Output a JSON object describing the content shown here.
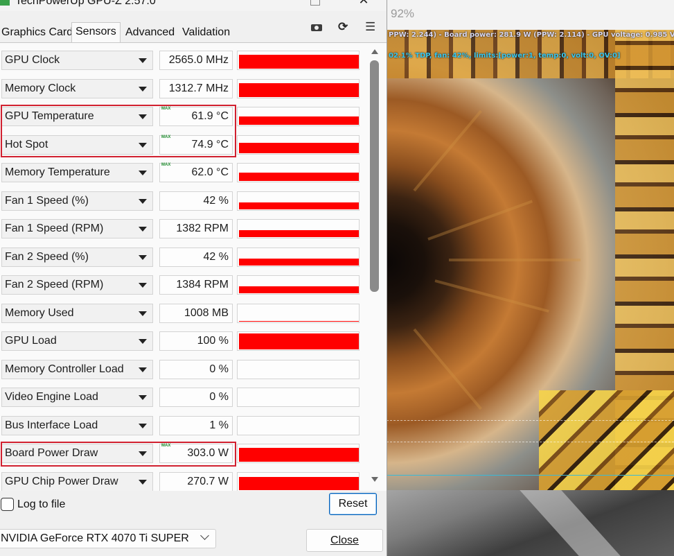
{
  "window": {
    "title": "TechPowerUp GPU-Z 2.57.0",
    "minimize_label": "—",
    "close_label": "✕"
  },
  "tabs": [
    {
      "label": "Graphics Card"
    },
    {
      "label": "Sensors",
      "active": true
    },
    {
      "label": "Advanced"
    },
    {
      "label": "Validation"
    }
  ],
  "toolbar": {
    "camera_icon": "camera-icon",
    "refresh_icon": "refresh-icon",
    "refresh_glyph": "⟳",
    "menu_icon": "hamburger-menu-icon",
    "menu_glyph": "☰"
  },
  "sensors": [
    {
      "name": "GPU Clock",
      "value": "2565.0 MHz",
      "max": false,
      "graph_level": 0.82,
      "highlighted": false
    },
    {
      "name": "Memory Clock",
      "value": "1312.7 MHz",
      "max": false,
      "graph_level": 0.85,
      "highlighted": false
    },
    {
      "name": "GPU Temperature",
      "value": "61.9 °C",
      "max": true,
      "max_label": "MAX",
      "graph_level": 0.5,
      "highlighted": true
    },
    {
      "name": "Hot Spot",
      "value": "74.9 °C",
      "max": true,
      "max_label": "MAX",
      "graph_level": 0.62,
      "highlighted": true
    },
    {
      "name": "Memory Temperature",
      "value": "62.0 °C",
      "max": true,
      "max_label": "MAX",
      "graph_level": 0.52,
      "highlighted": false
    },
    {
      "name": "Fan 1 Speed (%)",
      "value": "42 %",
      "max": false,
      "graph_level": 0.4,
      "highlighted": false
    },
    {
      "name": "Fan 1 Speed (RPM)",
      "value": "1382 RPM",
      "max": false,
      "graph_level": 0.4,
      "highlighted": false
    },
    {
      "name": "Fan 2 Speed (%)",
      "value": "42 %",
      "max": false,
      "graph_level": 0.4,
      "highlighted": false
    },
    {
      "name": "Fan 2 Speed (RPM)",
      "value": "1384 RPM",
      "max": false,
      "graph_level": 0.4,
      "highlighted": false
    },
    {
      "name": "Memory Used",
      "value": "1008 MB",
      "max": false,
      "graph_level": 0.06,
      "highlighted": false
    },
    {
      "name": "GPU Load",
      "value": "100 %",
      "max": false,
      "graph_level": 0.95,
      "highlighted": false
    },
    {
      "name": "Memory Controller Load",
      "value": "0 %",
      "max": false,
      "graph_level": 0,
      "highlighted": false
    },
    {
      "name": "Video Engine Load",
      "value": "0 %",
      "max": false,
      "graph_level": 0,
      "highlighted": false
    },
    {
      "name": "Bus Interface Load",
      "value": "1 %",
      "max": false,
      "graph_level": 0,
      "highlighted": false
    },
    {
      "name": "Board Power Draw",
      "value": "303.0 W",
      "max": true,
      "max_label": "MAX",
      "graph_level": 0.85,
      "highlighted": true
    },
    {
      "name": "GPU Chip Power Draw",
      "value": "270.7 W",
      "max": false,
      "graph_level": 0.8,
      "highlighted": false
    }
  ],
  "footer": {
    "log_label": "Log to file",
    "log_checked": false,
    "reset_label": "Reset",
    "gpu_select_value": "NVIDIA GeForce RTX 4070 Ti SUPER",
    "close_label": "Close"
  },
  "background_app": {
    "zoom": "92%",
    "osd_line1": "PPW: 2.244) - Board power: 281.9 W (PPW: 2.114) - GPU voltage: 0.985 V",
    "osd_line2": "02.1% TDP, fan: 42%, limits:[power:1, temp:0, volt:0, OV:0]"
  },
  "colors": {
    "graph": "#ff0000",
    "highlight_box": "#d1202f",
    "osd_primary": "#d8d8f2",
    "osd_secondary": "#38c6ee",
    "accent_button_border": "#005fb8"
  }
}
